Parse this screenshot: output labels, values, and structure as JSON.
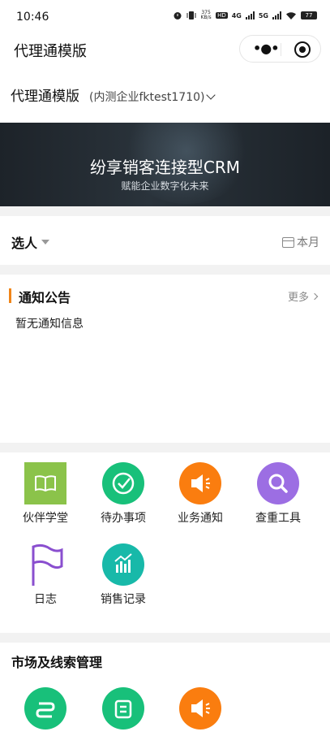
{
  "status_bar": {
    "time": "10:46",
    "net_speed_value": "375",
    "net_speed_unit": "KB/s",
    "hd_badge": "HD",
    "net1": "4G",
    "net2": "5G",
    "battery": "77"
  },
  "title_bar": {
    "title": "代理通模版",
    "more_icon": "more-dots-icon",
    "close_icon": "target-circle-icon"
  },
  "company": {
    "name": "代理通模版",
    "tenant": "(内测企业fktest1710)"
  },
  "banner": {
    "title": "纷享销客连接型CRM",
    "subtitle": "赋能企业数字化未来"
  },
  "filter": {
    "person_label": "选人",
    "period_label": "本月"
  },
  "notice": {
    "title": "通知公告",
    "more": "更多",
    "empty_text": "暂无通知信息",
    "accent": "#f08519"
  },
  "grid_items": [
    {
      "label": "伙伴学堂",
      "icon": "book-icon",
      "color": "#8bc34a"
    },
    {
      "label": "待办事项",
      "icon": "check-circle-icon",
      "color": "#18c07a"
    },
    {
      "label": "业务通知",
      "icon": "megaphone-icon",
      "color": "#fa7d0f"
    },
    {
      "label": "查重工具",
      "icon": "search-icon",
      "color": "#9c6ee3"
    },
    {
      "label": "日志",
      "icon": "flag-icon",
      "color": "#8a4fcf"
    },
    {
      "label": "销售记录",
      "icon": "chart-icon",
      "color": "#18b9a9"
    }
  ],
  "market_section": {
    "title": "市场及线索管理",
    "items": [
      {
        "icon": "route-icon",
        "color": "#18c07a"
      },
      {
        "icon": "letter-e-icon",
        "color": "#18c07a"
      },
      {
        "icon": "megaphone-icon",
        "color": "#fa7d0f"
      }
    ]
  }
}
